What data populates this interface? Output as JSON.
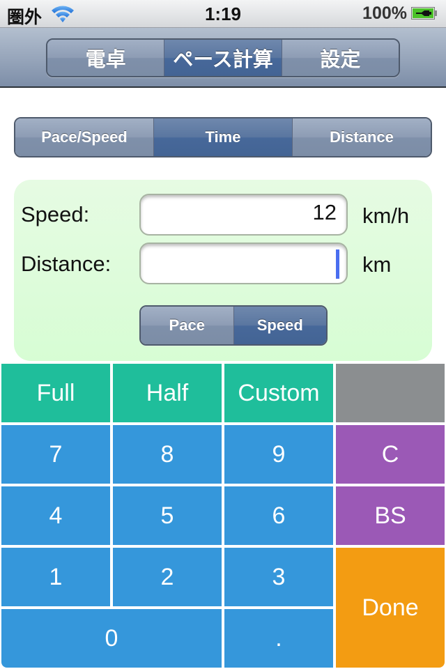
{
  "status_bar": {
    "carrier": "圏外",
    "wifi_icon": "wifi-icon",
    "time": "1:19",
    "battery_percent": "100%",
    "battery_icon": "battery-charging-icon"
  },
  "nav": {
    "tabs": [
      {
        "label": "電卓",
        "selected": false
      },
      {
        "label": "ペース計算",
        "selected": true
      },
      {
        "label": "設定",
        "selected": false
      }
    ]
  },
  "mode": {
    "tabs": [
      {
        "label": "Pace/Speed",
        "selected": false
      },
      {
        "label": "Time",
        "selected": true
      },
      {
        "label": "Distance",
        "selected": false
      }
    ]
  },
  "form": {
    "speed_label": "Speed:",
    "speed_value": "12",
    "speed_unit": "km/h",
    "distance_label": "Distance:",
    "distance_value": "",
    "distance_unit": "km",
    "toggle": [
      {
        "label": "Pace",
        "selected": false
      },
      {
        "label": "Speed",
        "selected": true
      }
    ]
  },
  "keypad": {
    "full": "Full",
    "half": "Half",
    "custom": "Custom",
    "blank": "",
    "k7": "7",
    "k8": "8",
    "k9": "9",
    "clear": "C",
    "k4": "4",
    "k5": "5",
    "k6": "6",
    "backspace": "BS",
    "k1": "1",
    "k2": "2",
    "k3": "3",
    "done": "Done",
    "k0": "0",
    "dot": ".",
    "colors": {
      "preset": "#1fbe9b",
      "blank": "#8b8e90",
      "digit": "#3597db",
      "edit": "#9b59b6",
      "done": "#f39c12"
    }
  }
}
